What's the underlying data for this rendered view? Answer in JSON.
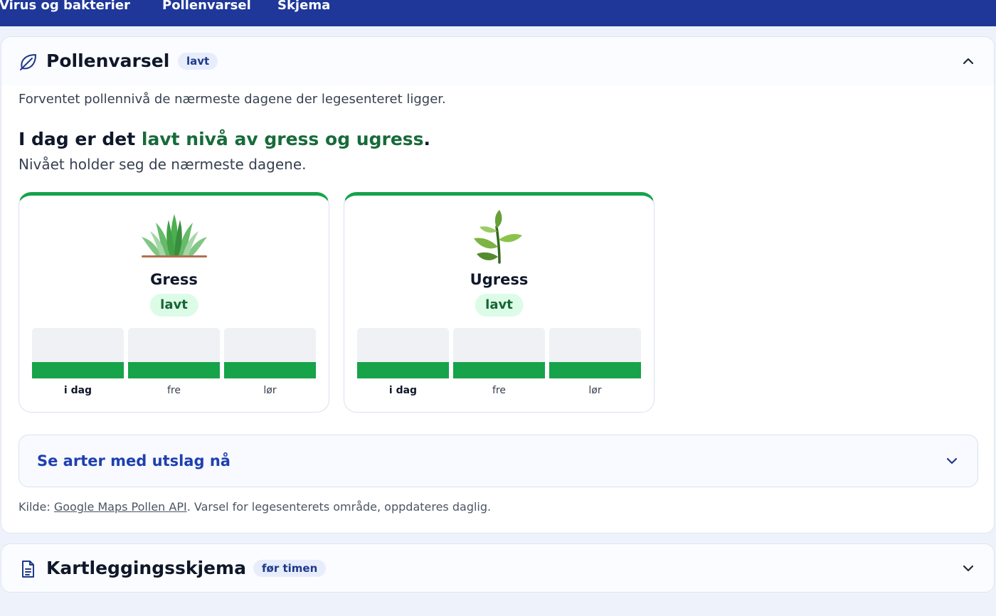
{
  "nav": {
    "items": [
      "Virus og bakterier",
      "Pollenvarsel",
      "Skjema"
    ]
  },
  "pollen": {
    "title": "Pollenvarsel",
    "badge": "lavt",
    "intro": "Forventet pollennivå de nærmeste dagene der legesenteret ligger.",
    "headline": {
      "prefix": "I dag er det ",
      "highlight": "lavt nivå av gress og ugress",
      "suffix": "."
    },
    "subline": "Nivået holder seg de nærmeste dagene.",
    "plants": [
      {
        "name": "Gress",
        "icon": "grass-icon",
        "level": "lavt",
        "days": [
          {
            "label": "i dag",
            "fill": 0.33
          },
          {
            "label": "fre",
            "fill": 0.33
          },
          {
            "label": "lør",
            "fill": 0.33
          }
        ]
      },
      {
        "name": "Ugress",
        "icon": "seedling-icon",
        "level": "lavt",
        "days": [
          {
            "label": "i dag",
            "fill": 0.33
          },
          {
            "label": "fre",
            "fill": 0.33
          },
          {
            "label": "lør",
            "fill": 0.33
          }
        ]
      }
    ],
    "species_toggle": "Se arter med utslag nå",
    "source": {
      "prefix": "Kilde: ",
      "link": "Google Maps Pollen API",
      "suffix": ". Varsel for legesenterets område, oppdateres daglig."
    }
  },
  "survey": {
    "title": "Kartleggingsskjema",
    "badge": "før timen"
  },
  "colors": {
    "nav_bg": "#1e3799",
    "low_green": "#16a34a",
    "headline_green": "#176b3a",
    "link_blue": "#1e40af"
  }
}
